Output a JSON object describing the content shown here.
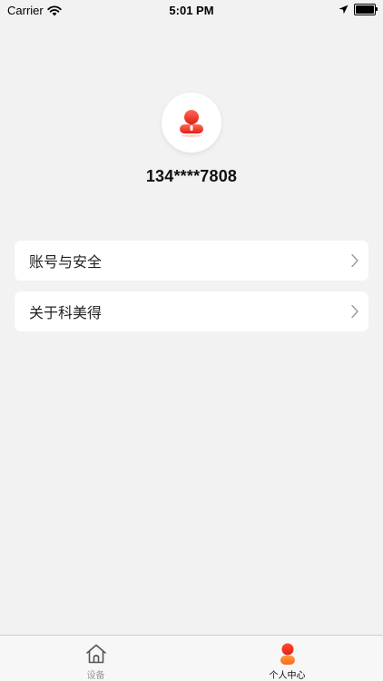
{
  "status_bar": {
    "carrier": "Carrier",
    "time": "5:01 PM"
  },
  "profile": {
    "phone": "134****7808",
    "accent_color": "#e8281e"
  },
  "menu": [
    {
      "label": "账号与安全"
    },
    {
      "label": "关于科美得"
    }
  ],
  "tabbar": {
    "tabs": [
      {
        "label": "设备",
        "icon": "home-icon",
        "active": false
      },
      {
        "label": "个人中心",
        "icon": "person-icon",
        "active": true
      }
    ]
  }
}
